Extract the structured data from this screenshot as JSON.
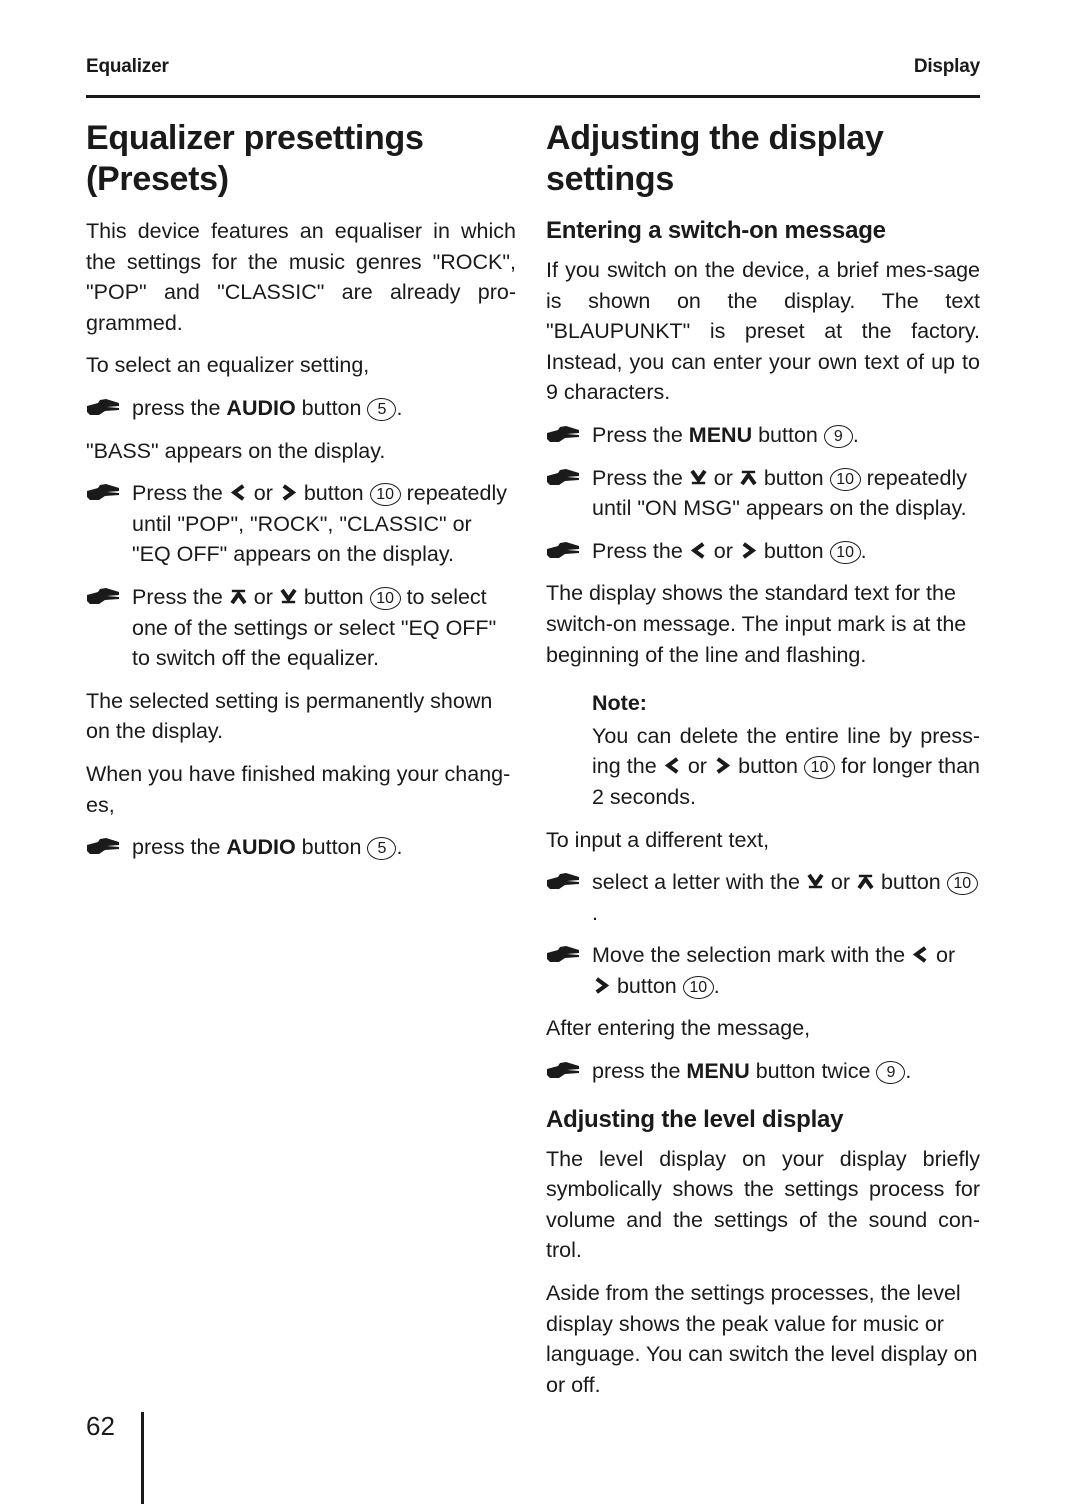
{
  "header": {
    "left": "Equalizer",
    "right": "Display"
  },
  "left_column": {
    "title": "Equalizer presettings (Presets)",
    "intro": "This device features an equaliser in which the settings for the music genres \"ROCK\", \"POP\" and \"CLASSIC\" are already pro-grammed.",
    "lead_select": "To select an equalizer setting,",
    "step1": {
      "pre": "press the ",
      "bold": "AUDIO",
      "mid": " button ",
      "ref": "5",
      "post": "."
    },
    "bass_line": "\"BASS\" appears on the display.",
    "step2": {
      "pre": "Press the ",
      "arrow1": "left-chevron",
      "or": " or ",
      "arrow2": "right-chevron",
      "mid": " button ",
      "ref": "10",
      "post": " repeatedly until \"POP\", \"ROCK\", \"CLASSIC\" or \"EQ OFF\" appears on the display."
    },
    "step3": {
      "pre": "Press the ",
      "arrow1": "up-bar-arrow",
      "or": " or ",
      "arrow2": "down-bar-arrow",
      "mid": " button ",
      "ref": "10",
      "post": " to select one of the settings or select \"EQ OFF\" to switch off the equalizer."
    },
    "permanent_line": "The selected setting is permanently shown on the display.",
    "finished_line": "When you have finished making your chang-es,",
    "step4": {
      "pre": "press the ",
      "bold": "AUDIO",
      "mid": " button ",
      "ref": "5",
      "post": "."
    }
  },
  "right_column": {
    "title": "Adjusting the display settings",
    "subtitle_switch_on": "Entering a switch-on message",
    "switch_on_intro": "If you switch on the device, a brief mes-sage is shown on the display. The text \"BLAUPUNKT\" is preset at the factory. Instead, you can enter your own text of up to 9 characters.",
    "step1": {
      "pre": "Press the ",
      "bold": "MENU",
      "mid": " button ",
      "ref": "9",
      "post": "."
    },
    "step2": {
      "pre": "Press the ",
      "arrow1": "down-bar-arrow",
      "or": " or ",
      "arrow2": "up-bar-arrow",
      "mid": " button ",
      "ref": "10",
      "post": " repeatedly until \"ON MSG\" appears on the display."
    },
    "step3": {
      "pre": "Press the ",
      "arrow1": "left-chevron",
      "or": " or ",
      "arrow2": "right-chevron",
      "mid": " button ",
      "ref": "10",
      "post": "."
    },
    "standard_text_para": "The display shows the standard text for the switch-on message. The input mark is at the beginning of the line and flashing.",
    "note": {
      "label": "Note:",
      "pre": "You can delete the entire line by press-ing the ",
      "arrow1": "left-chevron",
      "or": " or ",
      "arrow2": "right-chevron",
      "mid": " button ",
      "ref": "10",
      "post": " for longer than 2 seconds."
    },
    "lead_input": "To input a different text,",
    "step4": {
      "pre": "select a letter with the ",
      "arrow1": "down-bar-arrow",
      "or": " or ",
      "arrow2": "up-bar-arrow",
      "mid": " button ",
      "ref": "10",
      "post": "."
    },
    "step5": {
      "pre": "Move the selection mark with the ",
      "arrow1": "left-chevron",
      "or": " or ",
      "arrow2": "right-chevron",
      "mid": " button ",
      "ref": "10",
      "post": "."
    },
    "lead_after": "After entering the message,",
    "step6": {
      "pre": "press the ",
      "bold": "MENU",
      "mid": " button twice ",
      "ref": "9",
      "post": "."
    },
    "subtitle_level": "Adjusting the level display",
    "level_para1": "The level display on your display briefly symbolically shows the settings process for volume and the settings of the sound con-trol.",
    "level_para2": "Aside from the settings processes, the level display shows the peak value for music or language. You can switch the level display on or off."
  },
  "footer": {
    "page_number": "62"
  },
  "colors": {
    "text": "#1a1a1a",
    "background": "#ffffff"
  }
}
